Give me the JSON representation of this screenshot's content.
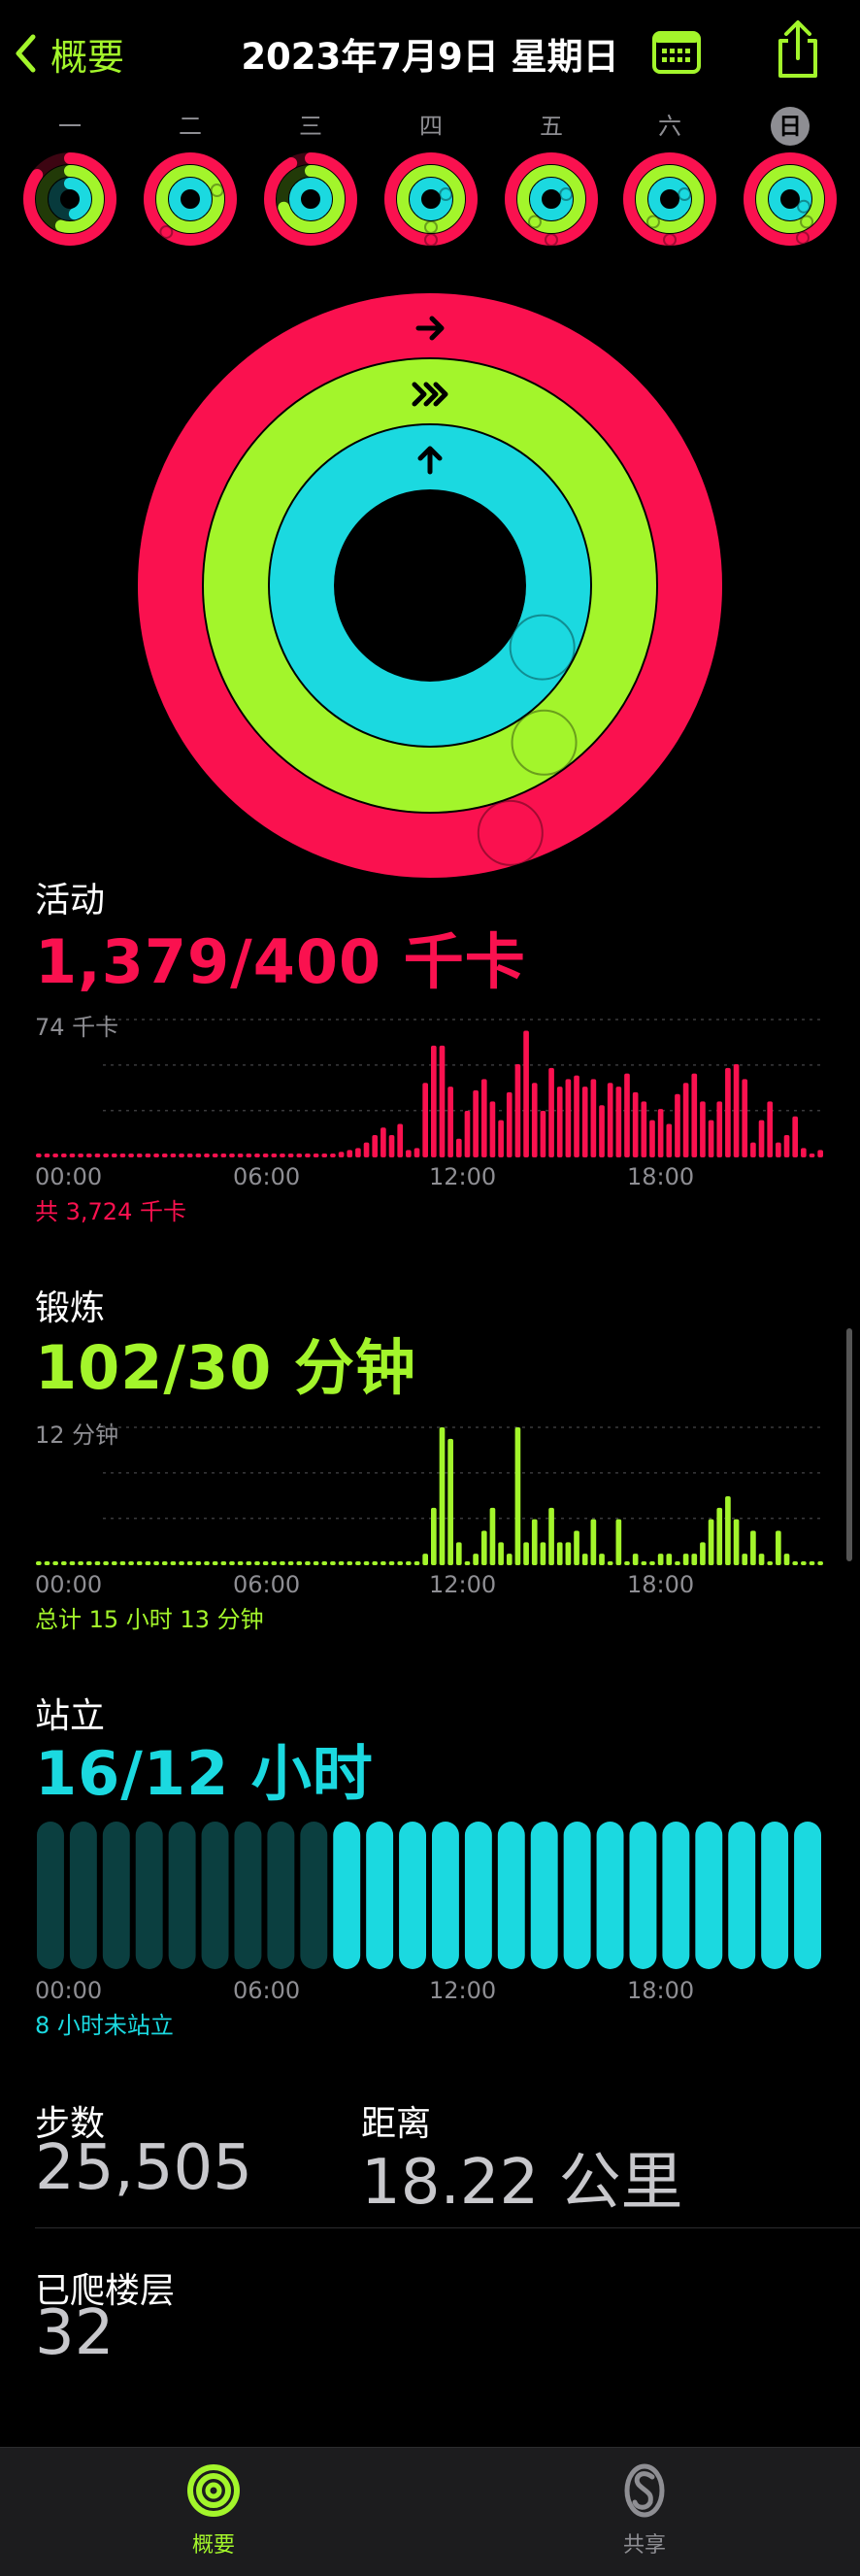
{
  "nav": {
    "back_label": "概要",
    "title": "2023年7月9日 星期日",
    "calendar_icon": "calendar-icon",
    "share_icon": "share-icon",
    "accent_color": "#a3f52b"
  },
  "week": [
    {
      "label": "一",
      "move": 0.85,
      "exercise": 0.55,
      "stand": 0.45,
      "today": false
    },
    {
      "label": "二",
      "move": 1.6,
      "exercise": 1.2,
      "stand": 1.0,
      "today": false
    },
    {
      "label": "三",
      "move": 0.92,
      "exercise": 0.7,
      "stand": 1.0,
      "today": false
    },
    {
      "label": "四",
      "move": 1.5,
      "exercise": 1.5,
      "stand": 1.2,
      "today": false
    },
    {
      "label": "五",
      "move": 1.5,
      "exercise": 1.6,
      "stand": 1.2,
      "today": false
    },
    {
      "label": "六",
      "move": 1.5,
      "exercise": 1.6,
      "stand": 1.2,
      "today": false
    },
    {
      "label": "日",
      "move": 3.45,
      "exercise": 3.4,
      "stand": 1.33,
      "today": true
    }
  ],
  "colors": {
    "move": "#fa114f",
    "move_dark": "#3d0512",
    "exercise": "#a3f52b",
    "exercise_dark": "#223a08",
    "stand": "#1bd9e0",
    "stand_dark": "#073a3c",
    "stand_inactive": "#0b3f40"
  },
  "activity": {
    "title": "活动",
    "value": "1,379/400 千卡",
    "y_max_label": "74 千卡",
    "summary": "共 3,724 千卡",
    "color": "#fa114f"
  },
  "exercise": {
    "title": "锻炼",
    "value": "102/30 分钟",
    "y_max_label": "12 分钟",
    "summary": "总计 15 小时 13 分钟",
    "color": "#a3f52b"
  },
  "stand": {
    "title": "站立",
    "value": "16/12 小时",
    "summary": "8 小时未站立",
    "color": "#1bd9e0",
    "hours_active": [
      false,
      false,
      false,
      false,
      false,
      false,
      false,
      false,
      false,
      true,
      true,
      true,
      true,
      true,
      true,
      true,
      true,
      true,
      true,
      true,
      true,
      true,
      true,
      true
    ]
  },
  "time_axis": [
    "00:00",
    "06:00",
    "12:00",
    "18:00"
  ],
  "stats": {
    "steps_label": "步数",
    "steps_value": "25,505",
    "distance_label": "距离",
    "distance_value": "18.22 公里",
    "floors_label": "已爬楼层",
    "floors_value": "32"
  },
  "tabs": [
    {
      "label": "概要",
      "icon": "activity-rings-icon",
      "active": true
    },
    {
      "label": "共享",
      "icon": "sharing-icon",
      "active": false
    }
  ],
  "chart_data": [
    {
      "type": "bar",
      "title": "活动",
      "ylabel": "千卡",
      "ylim": [
        0,
        74
      ],
      "x": [
        "00:00",
        "00:15",
        "00:30",
        "00:45",
        "01:00",
        "01:15",
        "01:30",
        "01:45",
        "02:00",
        "02:15",
        "02:30",
        "02:45",
        "03:00",
        "03:15",
        "03:30",
        "03:45",
        "04:00",
        "04:15",
        "04:30",
        "04:45",
        "05:00",
        "05:15",
        "05:30",
        "05:45",
        "06:00",
        "06:15",
        "06:30",
        "06:45",
        "07:00",
        "07:15",
        "07:30",
        "07:45",
        "08:00",
        "08:15",
        "08:30",
        "08:45",
        "09:00",
        "09:15",
        "09:30",
        "09:45",
        "10:00",
        "10:15",
        "10:30",
        "10:45",
        "11:00",
        "11:15",
        "11:30",
        "11:45",
        "12:00",
        "12:15",
        "12:30",
        "12:45",
        "13:00",
        "13:15",
        "13:30",
        "13:45",
        "14:00",
        "14:15",
        "14:30",
        "14:45",
        "15:00",
        "15:15",
        "15:30",
        "15:45",
        "16:00",
        "16:15",
        "16:30",
        "16:45",
        "17:00",
        "17:15",
        "17:30",
        "17:45",
        "18:00",
        "18:15",
        "18:30",
        "18:45",
        "19:00",
        "19:15",
        "19:30",
        "19:45",
        "20:00",
        "20:15",
        "20:30",
        "20:45",
        "21:00",
        "21:15",
        "21:30",
        "21:45",
        "22:00",
        "22:15",
        "22:30",
        "22:45",
        "23:00",
        "23:15",
        "23:30",
        "23:45"
      ],
      "values": [
        2,
        2,
        2,
        2,
        2,
        2,
        2,
        2,
        2,
        2,
        2,
        2,
        2,
        2,
        2,
        2,
        2,
        2,
        2,
        2,
        2,
        2,
        2,
        2,
        2,
        2,
        2,
        2,
        2,
        2,
        2,
        2,
        2,
        2,
        2,
        2,
        3,
        4,
        5,
        8,
        12,
        16,
        12,
        18,
        4,
        5,
        40,
        60,
        60,
        38,
        10,
        25,
        36,
        42,
        30,
        20,
        35,
        50,
        68,
        40,
        25,
        48,
        38,
        42,
        44,
        38,
        42,
        28,
        40,
        38,
        45,
        35,
        30,
        20,
        26,
        18,
        34,
        40,
        45,
        30,
        20,
        30,
        48,
        50,
        42,
        8,
        20,
        30,
        8,
        12,
        22,
        5,
        2,
        4
      ],
      "summary": "共 3,724 千卡"
    },
    {
      "type": "bar",
      "title": "锻炼",
      "ylabel": "分钟",
      "ylim": [
        0,
        12
      ],
      "x": [
        "00:00",
        "00:15",
        "00:30",
        "00:45",
        "01:00",
        "01:15",
        "01:30",
        "01:45",
        "02:00",
        "02:15",
        "02:30",
        "02:45",
        "03:00",
        "03:15",
        "03:30",
        "03:45",
        "04:00",
        "04:15",
        "04:30",
        "04:45",
        "05:00",
        "05:15",
        "05:30",
        "05:45",
        "06:00",
        "06:15",
        "06:30",
        "06:45",
        "07:00",
        "07:15",
        "07:30",
        "07:45",
        "08:00",
        "08:15",
        "08:30",
        "08:45",
        "09:00",
        "09:15",
        "09:30",
        "09:45",
        "10:00",
        "10:15",
        "10:30",
        "10:45",
        "11:00",
        "11:15",
        "11:30",
        "11:45",
        "12:00",
        "12:15",
        "12:30",
        "12:45",
        "13:00",
        "13:15",
        "13:30",
        "13:45",
        "14:00",
        "14:15",
        "14:30",
        "14:45",
        "15:00",
        "15:15",
        "15:30",
        "15:45",
        "16:00",
        "16:15",
        "16:30",
        "16:45",
        "17:00",
        "17:15",
        "17:30",
        "17:45",
        "18:00",
        "18:15",
        "18:30",
        "18:45",
        "19:00",
        "19:15",
        "19:30",
        "19:45",
        "20:00",
        "20:15",
        "20:30",
        "20:45",
        "21:00",
        "21:15",
        "21:30",
        "21:45",
        "22:00",
        "22:15",
        "22:30",
        "22:45",
        "23:00",
        "23:15",
        "23:30",
        "23:45"
      ],
      "values": [
        0,
        0,
        0,
        0,
        0,
        0,
        0,
        0,
        0,
        0,
        0,
        0,
        0,
        0,
        0,
        0,
        0,
        0,
        0,
        0,
        0,
        0,
        0,
        0,
        0,
        0,
        0,
        0,
        0,
        0,
        0,
        0,
        0,
        0,
        0,
        0,
        0,
        0,
        0,
        0,
        0,
        0,
        0,
        0,
        0,
        0,
        1,
        5,
        12,
        11,
        2,
        0,
        1,
        3,
        5,
        2,
        1,
        12,
        2,
        4,
        2,
        5,
        2,
        2,
        3,
        1,
        4,
        1,
        0,
        4,
        0,
        1,
        0,
        0,
        1,
        1,
        0,
        1,
        1,
        2,
        4,
        5,
        6,
        4,
        1,
        3,
        1,
        0,
        3,
        1,
        0,
        0,
        0,
        0
      ],
      "summary": "总计 15 小时 13 分钟"
    }
  ]
}
